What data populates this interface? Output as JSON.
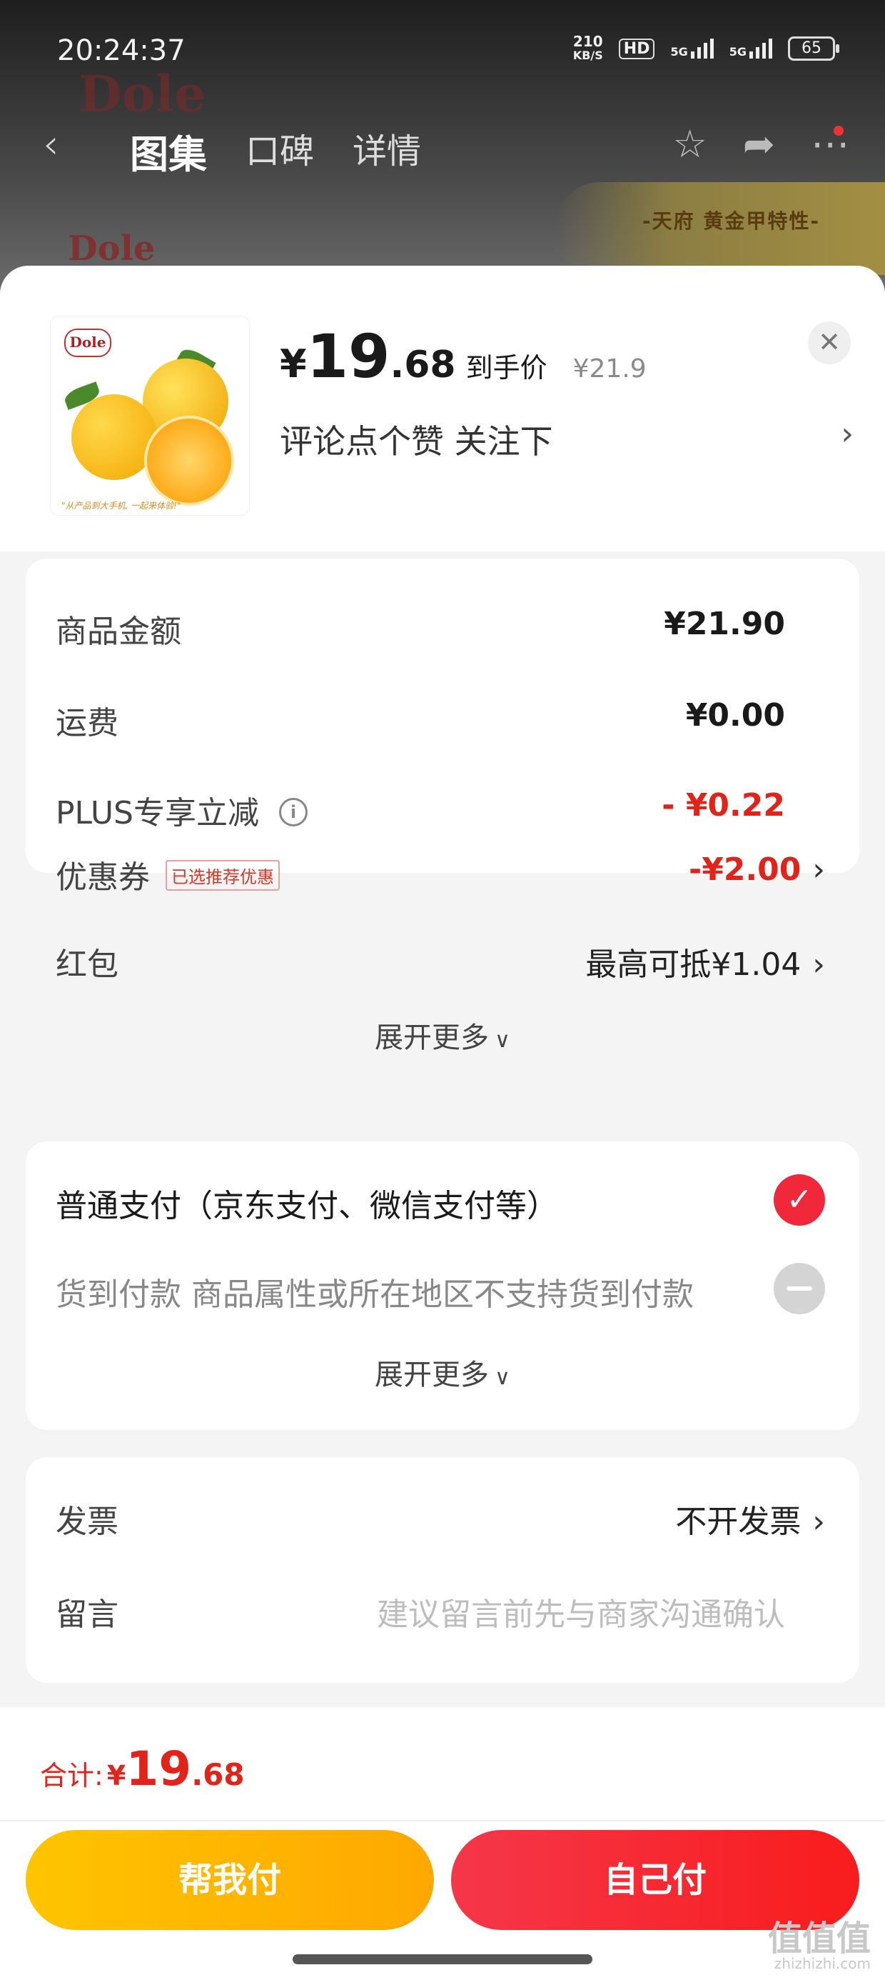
{
  "status_bar": {
    "time": "20:24:37",
    "net_speed_value": "210",
    "net_speed_unit": "KB/S",
    "hd": "HD",
    "sig1": "5G",
    "sig2": "5G",
    "battery": "65"
  },
  "nav": {
    "tabs": [
      "图集",
      "口碑",
      "详情"
    ],
    "active_tab": "图集"
  },
  "background": {
    "brand": "Dole",
    "banner_text": "-天府 黄金甲特性-"
  },
  "product": {
    "logo": "Dole",
    "thumb_caption": "\"从产品到大手机, 一起来体验!\"",
    "price_yen": "¥",
    "price_int": "19",
    "price_dec": ".68",
    "price_label": "到手价",
    "original_price": "¥21.9",
    "promo_text": "评论点个赞 关注下"
  },
  "summary": {
    "rows": [
      {
        "label": "商品金额",
        "value": "¥21.90"
      },
      {
        "label": "运费",
        "value": "¥0.00"
      },
      {
        "label": "PLUS专享立减",
        "value": "- ¥0.22"
      },
      {
        "label": "优惠券",
        "tag": "已选推荐优惠",
        "value": "-¥2.00"
      },
      {
        "label": "红包",
        "value": "最高可抵¥1.04"
      }
    ],
    "expand_more": "展开更多"
  },
  "payment": {
    "options": [
      {
        "label": "普通支付（京东支付、微信支付等）"
      },
      {
        "label": "货到付款 商品属性或所在地区不支持货到付款"
      }
    ],
    "expand_more": "展开更多"
  },
  "invoice": {
    "label": "发票",
    "value": "不开发票"
  },
  "message": {
    "label": "留言",
    "placeholder": "建议留言前先与商家沟通确认"
  },
  "footer": {
    "total_label": "合计:",
    "total_yen": "¥",
    "total_int": "19",
    "total_dec": ".68",
    "help_pay": "帮我付",
    "self_pay": "自己付"
  },
  "watermark": {
    "main": "值值值",
    "sub": "zhizhizhi.com"
  },
  "colors": {
    "accent_red": "#e2231a",
    "help_yellow": "#ffb800",
    "pay_red": "#f5283a"
  }
}
